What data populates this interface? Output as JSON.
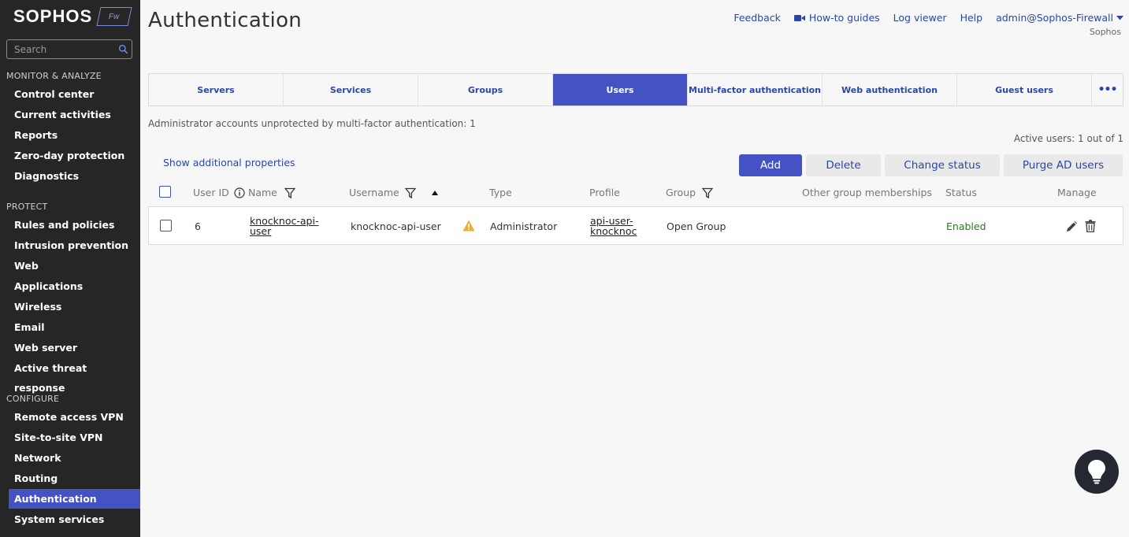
{
  "sidebar": {
    "logo": "SOPHOS",
    "logo_badge": "Fw",
    "search_placeholder": "Search",
    "sections": [
      {
        "label": "MONITOR & ANALYZE",
        "items": [
          "Control center",
          "Current activities",
          "Reports",
          "Zero-day protection",
          "Diagnostics"
        ]
      },
      {
        "label": "PROTECT",
        "items": [
          "Rules and policies",
          "Intrusion prevention",
          "Web",
          "Applications",
          "Wireless",
          "Email",
          "Web server",
          "Active threat response"
        ]
      },
      {
        "label": "CONFIGURE",
        "items": [
          "Remote access VPN",
          "Site-to-site VPN",
          "Network",
          "Routing",
          "Authentication",
          "System services"
        ]
      }
    ],
    "active_item": "Authentication"
  },
  "header": {
    "title": "Authentication",
    "links": {
      "feedback": "Feedback",
      "howto": "How-to guides",
      "log_viewer": "Log viewer",
      "help": "Help",
      "account": "admin@Sophos-Firewall"
    },
    "account_sub": "Sophos"
  },
  "tabs": [
    "Servers",
    "Services",
    "Groups",
    "Users",
    "Multi-factor authentication",
    "Web authentication",
    "Guest users"
  ],
  "tab_more": "•••",
  "active_tab": "Users",
  "notice": "Administrator accounts unprotected by multi-factor authentication: 1",
  "active_users": "Active users: 1 out of 1",
  "show_props": "Show additional properties",
  "actions": {
    "add": "Add",
    "delete": "Delete",
    "change_status": "Change status",
    "purge": "Purge AD users"
  },
  "columns": {
    "user_id": "User ID",
    "name": "Name",
    "username": "Username",
    "type": "Type",
    "profile": "Profile",
    "group": "Group",
    "other_groups": "Other group memberships",
    "status": "Status",
    "manage": "Manage"
  },
  "rows": [
    {
      "user_id": "6",
      "name_line1": "knocknoc-api-",
      "name_line2": "user",
      "username": "knocknoc-api-user",
      "type": "Administrator",
      "profile_line1": "api-user-",
      "profile_line2": "knocknoc",
      "group": "Open Group",
      "other_groups": "",
      "status": "Enabled"
    }
  ],
  "colors": {
    "sidebar_bg": "#262626",
    "accent": "#4452c4",
    "link": "#2a47a8",
    "enabled": "#2a7a1e",
    "warning": "#e8b130"
  }
}
